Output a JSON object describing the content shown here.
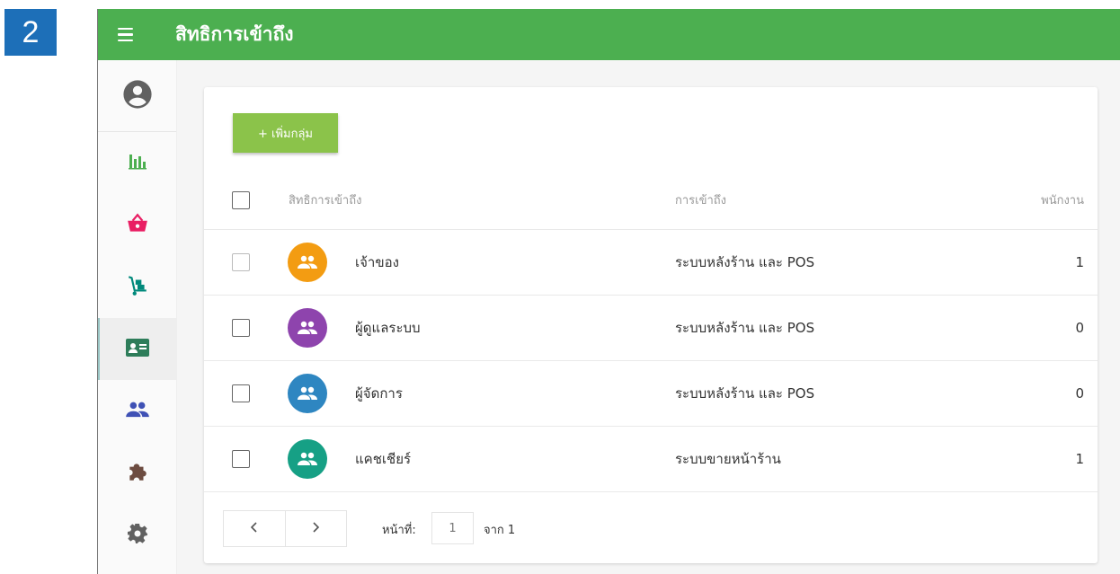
{
  "step_badge": "2",
  "header": {
    "title": "สิทธิการเข้าถึง"
  },
  "sidebar": {
    "items": [
      {
        "icon": "account-circle-icon",
        "color": "#616161"
      },
      {
        "icon": "bar-chart-icon",
        "color": "#4caf50"
      },
      {
        "icon": "shopping-basket-icon",
        "color": "#e91e63"
      },
      {
        "icon": "hand-truck-icon",
        "color": "#00897b"
      },
      {
        "icon": "id-card-icon",
        "color": "#2e7d5a",
        "active": true
      },
      {
        "icon": "people-icon",
        "color": "#3f51b5"
      },
      {
        "icon": "puzzle-icon",
        "color": "#6d4c41"
      },
      {
        "icon": "gear-icon",
        "color": "#616161"
      }
    ]
  },
  "toolbar": {
    "add_label": "+ เพิ่มกลุ่ม"
  },
  "table": {
    "columns": {
      "name": "สิทธิการเข้าถึง",
      "access": "การเข้าถึง",
      "staff": "พนักงาน"
    },
    "rows": [
      {
        "name": "เจ้าของ",
        "access": "ระบบหลังร้าน และ POS",
        "staff": "1",
        "color": "#f39c12"
      },
      {
        "name": "ผู้ดูแลระบบ",
        "access": "ระบบหลังร้าน และ POS",
        "staff": "0",
        "color": "#8e44ad"
      },
      {
        "name": "ผู้จัดการ",
        "access": "ระบบหลังร้าน และ POS",
        "staff": "0",
        "color": "#2e86c1"
      },
      {
        "name": "แคชเชียร์",
        "access": "ระบบขายหน้าร้าน",
        "staff": "1",
        "color": "#16a085"
      }
    ]
  },
  "pagination": {
    "prev": "<",
    "next": ">",
    "page_label": "หน้าที่:",
    "page_value": "1",
    "total_label": "จาก 1"
  }
}
